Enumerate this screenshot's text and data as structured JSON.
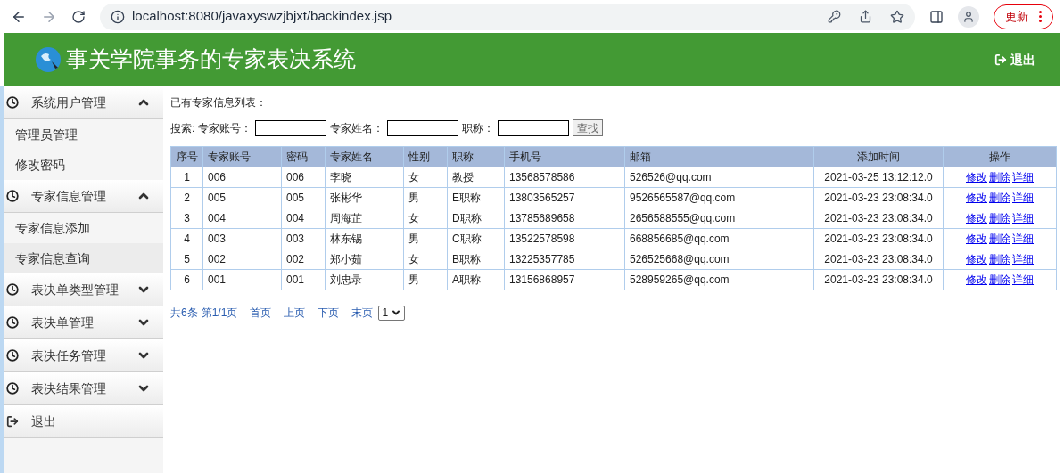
{
  "browser": {
    "url": "localhost:8080/javaxyswzjbjxt/backindex.jsp",
    "update_label": "更新"
  },
  "header": {
    "title": "事关学院事务的专家表决系统",
    "logout": "退出"
  },
  "sidebar": {
    "groups": [
      {
        "label": "系统用户管理",
        "expanded": true,
        "children": [
          {
            "label": "管理员管理",
            "selected": false
          },
          {
            "label": "修改密码",
            "selected": false
          }
        ]
      },
      {
        "label": "专家信息管理",
        "expanded": true,
        "children": [
          {
            "label": "专家信息添加",
            "selected": false
          },
          {
            "label": "专家信息查询",
            "selected": true
          }
        ]
      },
      {
        "label": "表决单类型管理",
        "expanded": false
      },
      {
        "label": "表决单管理",
        "expanded": false
      },
      {
        "label": "表决任务管理",
        "expanded": false
      },
      {
        "label": "表决结果管理",
        "expanded": false
      }
    ],
    "logout": "退出"
  },
  "content": {
    "heading": "已有专家信息列表：",
    "search": {
      "prefix": "搜索:",
      "fields": [
        "专家账号：",
        "专家姓名：",
        "职称："
      ],
      "button": "查找"
    },
    "table": {
      "columns": [
        "序号",
        "专家账号",
        "密码",
        "专家姓名",
        "性别",
        "职称",
        "手机号",
        "邮箱",
        "添加时间",
        "操作"
      ],
      "rows": [
        {
          "cells": [
            "1",
            "006",
            "006",
            "李晓",
            "女",
            "教授",
            "13568578586",
            "526526@qq.com",
            "2021-03-25 13:12:12.0"
          ],
          "actions": [
            "修改",
            "删除",
            "详细"
          ]
        },
        {
          "cells": [
            "2",
            "005",
            "005",
            "张彬华",
            "男",
            "E职称",
            "13803565257",
            "9526565587@qq.com",
            "2021-03-23 23:08:34.0"
          ],
          "actions": [
            "修改",
            "删除",
            "详细"
          ]
        },
        {
          "cells": [
            "3",
            "004",
            "004",
            "周海芷",
            "女",
            "D职称",
            "13785689658",
            "2656588555@qq.com",
            "2021-03-23 23:08:34.0"
          ],
          "actions": [
            "修改",
            "删除",
            "详细"
          ]
        },
        {
          "cells": [
            "4",
            "003",
            "003",
            "林东锡",
            "男",
            "C职称",
            "13522578598",
            "668856685@qq.com",
            "2021-03-23 23:08:34.0"
          ],
          "actions": [
            "修改",
            "删除",
            "详细"
          ]
        },
        {
          "cells": [
            "5",
            "002",
            "002",
            "郑小茹",
            "女",
            "B职称",
            "13225357785",
            "526525668@qq.com",
            "2021-03-23 23:08:34.0"
          ],
          "actions": [
            "修改",
            "删除",
            "详细"
          ]
        },
        {
          "cells": [
            "6",
            "001",
            "001",
            "刘忠录",
            "男",
            "A职称",
            "13156868957",
            "528959265@qq.com",
            "2021-03-23 23:08:34.0"
          ],
          "actions": [
            "修改",
            "删除",
            "详细"
          ]
        }
      ]
    },
    "pagination": {
      "total": "共6条",
      "page": "第1/1页",
      "links": [
        "首页",
        "上页",
        "下页",
        "末页"
      ],
      "select_value": "1"
    }
  }
}
